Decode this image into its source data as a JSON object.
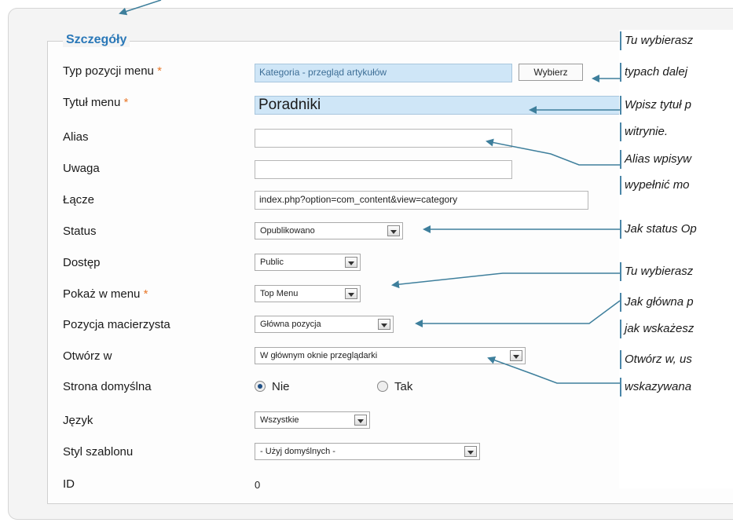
{
  "legend": "Szczegóły",
  "fields": {
    "menu_item_type": {
      "label": "Typ pozycji menu",
      "required": "*",
      "value": "Kategoria - przegląd artykułów",
      "button": "Wybierz"
    },
    "menu_title": {
      "label": "Tytuł menu",
      "required": "*",
      "value": "Poradniki"
    },
    "alias": {
      "label": "Alias",
      "value": ""
    },
    "note": {
      "label": "Uwaga",
      "value": ""
    },
    "link": {
      "label": "Łącze",
      "value": "index.php?option=com_content&view=category"
    },
    "status": {
      "label": "Status",
      "value": "Opublikowano"
    },
    "access": {
      "label": "Dostęp",
      "value": "Public"
    },
    "show_in_menu": {
      "label": "Pokaż w menu",
      "required": "*",
      "value": "Top Menu"
    },
    "parent": {
      "label": "Pozycja macierzysta",
      "value": "Główna pozycja"
    },
    "open_in": {
      "label": "Otwórz w",
      "value": "W głównym oknie przeglądarki"
    },
    "default_page": {
      "label": "Strona domyślna",
      "option_no": "Nie",
      "option_yes": "Tak",
      "selected": "Nie"
    },
    "language": {
      "label": "Język",
      "value": "Wszystkie"
    },
    "template_style": {
      "label": "Styl szablonu",
      "value": "- Użyj domyślnych -"
    },
    "id": {
      "label": "ID",
      "value": "0"
    }
  },
  "annotations": [
    "Tu wybierasz",
    "typach dalej",
    "Wpisz tytuł p",
    "witrynie.",
    "Alias wpisyw",
    "wypełnić mo",
    "Jak status Op",
    "Tu wybierasz",
    "Jak główna p",
    "jak wskażesz",
    "Otwórz w, us",
    "wskazywana"
  ],
  "colors": {
    "legend": "#2a78b8",
    "required": "#e8782a",
    "arrow": "#3e7f9c",
    "highlight_field": "#cfe6f7"
  }
}
